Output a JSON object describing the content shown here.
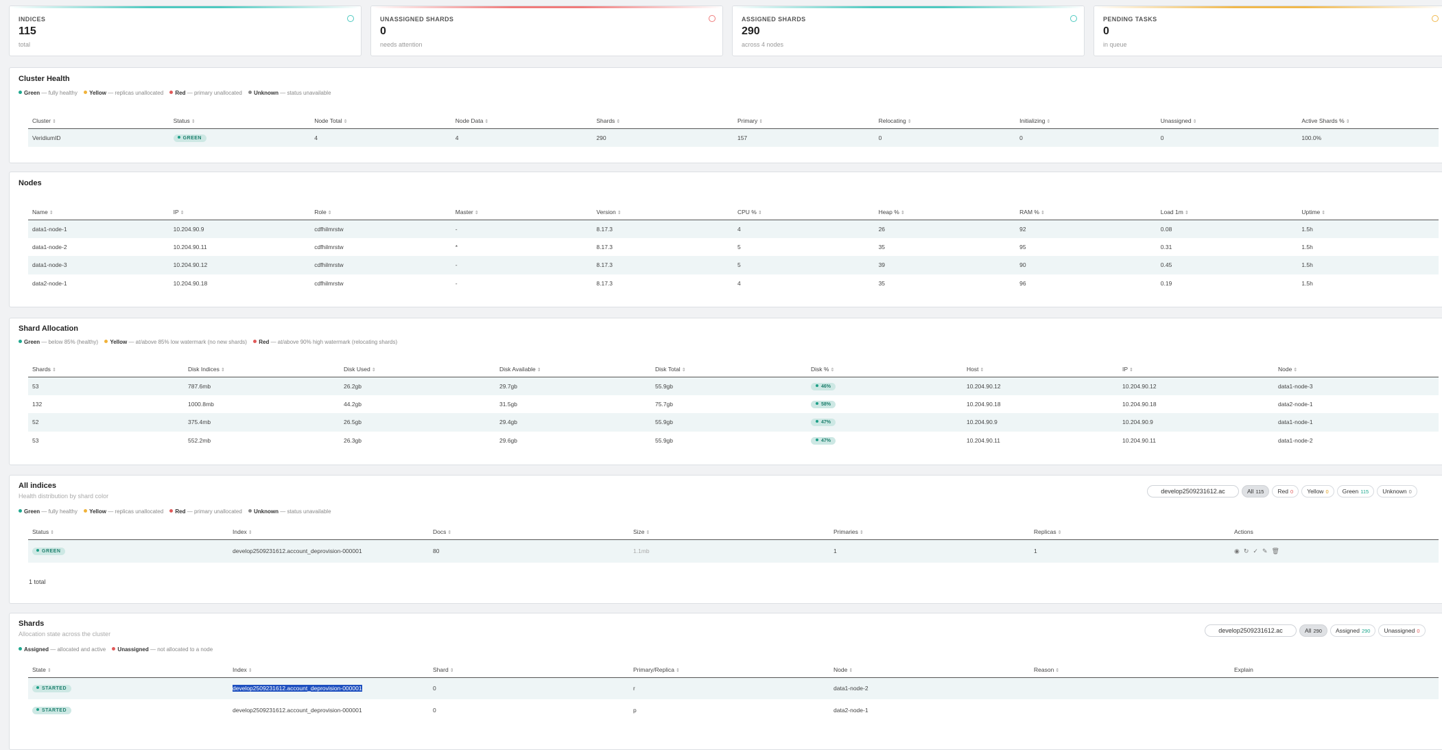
{
  "stats": [
    {
      "label": "INDICES",
      "value": "115",
      "sub": "total",
      "color": "#4ec9c0"
    },
    {
      "label": "UNASSIGNED SHARDS",
      "value": "0",
      "sub": "needs attention",
      "color": "#ef7b7b"
    },
    {
      "label": "ASSIGNED SHARDS",
      "value": "290",
      "sub": "across 4 nodes",
      "color": "#4ec9c0"
    },
    {
      "label": "PENDING TASKS",
      "value": "0",
      "sub": "in queue",
      "color": "#f0b84c"
    }
  ],
  "cluster_health": {
    "title": "Cluster Health",
    "legend": [
      {
        "name": "Green",
        "desc": "— fully healthy",
        "color": "#1fa88f"
      },
      {
        "name": "Yellow",
        "desc": "— replicas unallocated",
        "color": "#f0b23a"
      },
      {
        "name": "Red",
        "desc": "— primary unallocated",
        "color": "#e05a5a"
      },
      {
        "name": "Unknown",
        "desc": "— status unavailable",
        "color": "#888888"
      }
    ],
    "columns": [
      "Cluster",
      "Status",
      "Node Total",
      "Node Data",
      "Shards",
      "Primary",
      "Relocating",
      "Initializing",
      "Unassigned",
      "Active Shards %"
    ],
    "row": {
      "cluster": "VeridiumID",
      "status": "GREEN",
      "node_total": "4",
      "node_data": "4",
      "shards": "290",
      "primary": "157",
      "relocating": "0",
      "initializing": "0",
      "unassigned": "0",
      "active": "100.0%"
    }
  },
  "nodes": {
    "title": "Nodes",
    "columns": [
      "Name",
      "IP",
      "Role",
      "Master",
      "Version",
      "CPU %",
      "Heap %",
      "RAM %",
      "Load 1m",
      "Uptime"
    ],
    "rows": [
      [
        "data1-node-1",
        "10.204.90.9",
        "cdfhilmrstw",
        "-",
        "8.17.3",
        "4",
        "26",
        "92",
        "0.08",
        "1.5h"
      ],
      [
        "data1-node-2",
        "10.204.90.11",
        "cdfhilmrstw",
        "*",
        "8.17.3",
        "5",
        "35",
        "95",
        "0.31",
        "1.5h"
      ],
      [
        "data1-node-3",
        "10.204.90.12",
        "cdfhilmrstw",
        "-",
        "8.17.3",
        "5",
        "39",
        "90",
        "0.45",
        "1.5h"
      ],
      [
        "data2-node-1",
        "10.204.90.18",
        "cdfhilmrstw",
        "-",
        "8.17.3",
        "4",
        "35",
        "96",
        "0.19",
        "1.5h"
      ]
    ]
  },
  "shard_allocation": {
    "title": "Shard Allocation",
    "legend": [
      {
        "name": "Green",
        "desc": "— below 85% (healthy)",
        "color": "#1fa88f"
      },
      {
        "name": "Yellow",
        "desc": "— at/above 85% low watermark (no new shards)",
        "color": "#f0b23a"
      },
      {
        "name": "Red",
        "desc": "— at/above 90% high watermark (relocating shards)",
        "color": "#e05a5a"
      }
    ],
    "columns": [
      "Shards",
      "Disk Indices",
      "Disk Used",
      "Disk Available",
      "Disk Total",
      "Disk %",
      "Host",
      "IP",
      "Node"
    ],
    "rows": [
      [
        "53",
        "787.6mb",
        "26.2gb",
        "29.7gb",
        "55.9gb",
        "46%",
        "10.204.90.12",
        "10.204.90.12",
        "data1-node-3"
      ],
      [
        "132",
        "1000.8mb",
        "44.2gb",
        "31.5gb",
        "75.7gb",
        "58%",
        "10.204.90.18",
        "10.204.90.18",
        "data2-node-1"
      ],
      [
        "52",
        "375.4mb",
        "26.5gb",
        "29.4gb",
        "55.9gb",
        "47%",
        "10.204.90.9",
        "10.204.90.9",
        "data1-node-1"
      ],
      [
        "53",
        "552.2mb",
        "26.3gb",
        "29.6gb",
        "55.9gb",
        "47%",
        "10.204.90.11",
        "10.204.90.11",
        "data1-node-2"
      ]
    ]
  },
  "all_indices": {
    "title": "All indices",
    "subtitle": "Health distribution by shard color",
    "search_value": "develop2509231612.ac",
    "filters": [
      {
        "label": "All",
        "count": "115",
        "color": "#333"
      },
      {
        "label": "Red",
        "count": "0",
        "color": "#e05a5a"
      },
      {
        "label": "Yellow",
        "count": "0",
        "color": "#e0a020"
      },
      {
        "label": "Green",
        "count": "115",
        "color": "#1fa88f"
      },
      {
        "label": "Unknown",
        "count": "0",
        "color": "#888"
      }
    ],
    "legend": [
      {
        "name": "Green",
        "desc": "— fully healthy",
        "color": "#1fa88f"
      },
      {
        "name": "Yellow",
        "desc": "— replicas unallocated",
        "color": "#f0b23a"
      },
      {
        "name": "Red",
        "desc": "— primary unallocated",
        "color": "#e05a5a"
      },
      {
        "name": "Unknown",
        "desc": "— status unavailable",
        "color": "#888888"
      }
    ],
    "columns": [
      "Status",
      "Index",
      "Docs",
      "Size",
      "Primaries",
      "Replicas",
      "Actions"
    ],
    "row": {
      "status": "GREEN",
      "index": "develop2509231612.account_deprovision-000001",
      "docs": "80",
      "size": "1.1mb",
      "primaries": "1",
      "replicas": "1"
    },
    "action_icons": [
      "eye-icon",
      "refresh-icon",
      "check-icon",
      "edit-icon",
      "trash-icon"
    ],
    "total": "1 total"
  },
  "shards": {
    "title": "Shards",
    "subtitle": "Allocation state across the cluster",
    "search_value": "develop2509231612.ac",
    "filters": [
      {
        "label": "All",
        "count": "290",
        "color": "#333"
      },
      {
        "label": "Assigned",
        "count": "290",
        "color": "#1fa88f"
      },
      {
        "label": "Unassigned",
        "count": "0",
        "color": "#e05a5a"
      }
    ],
    "legend": [
      {
        "name": "Assigned",
        "desc": "— allocated and active",
        "color": "#1fa88f"
      },
      {
        "name": "Unassigned",
        "desc": "— not allocated to a node",
        "color": "#e05a5a"
      }
    ],
    "columns": [
      "State",
      "Index",
      "Shard",
      "Primary/Replica",
      "Node",
      "Reason",
      "Explain"
    ],
    "rows": [
      {
        "state": "STARTED",
        "index": "develop2509231612.account_deprovision-000001",
        "shard": "0",
        "pr": "r",
        "node": "data1-node-2",
        "reason": "",
        "explain": ""
      },
      {
        "state": "STARTED",
        "index": "develop2509231612.account_deprovision-000001",
        "shard": "0",
        "pr": "p",
        "node": "data2-node-1",
        "reason": "",
        "explain": ""
      }
    ]
  }
}
